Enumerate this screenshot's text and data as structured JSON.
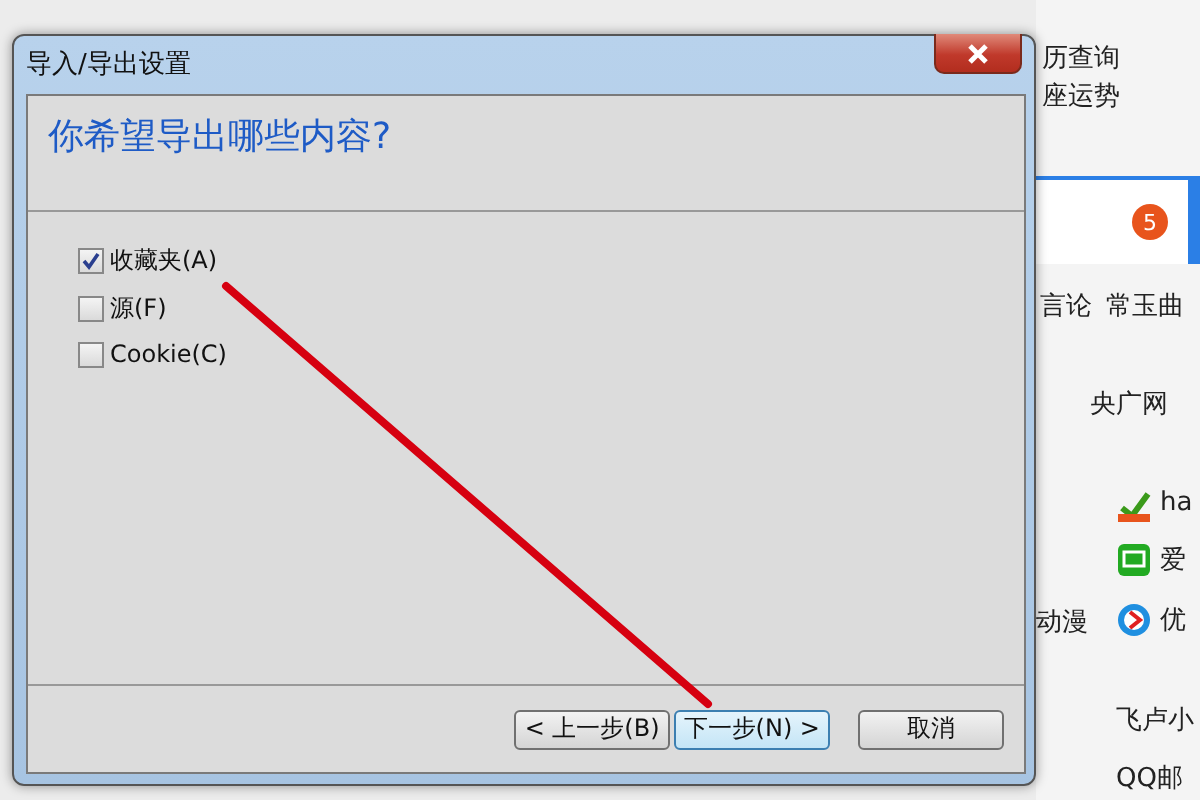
{
  "dialog": {
    "title": "导入/导出设置",
    "question": "你希望导出哪些内容?",
    "options": [
      {
        "label": "收藏夹(A)",
        "checked": true
      },
      {
        "label": "源(F)",
        "checked": false
      },
      {
        "label": "Cookie(C)",
        "checked": false
      }
    ],
    "buttons": [
      {
        "label": "< 上一步(B)",
        "focused": false
      },
      {
        "label": "下一步(N) >",
        "focused": true
      },
      {
        "label": "取消",
        "focused": false
      }
    ]
  },
  "background_page": {
    "links_top": [
      "历查询",
      "座运势"
    ],
    "badge": "5",
    "links_mid": [
      "言论",
      "常玉曲"
    ],
    "site": "央广网",
    "sites": [
      "ha",
      "爱",
      "优"
    ],
    "side_link": "动漫",
    "links_bottom": [
      "飞卢小",
      "QQ邮"
    ]
  }
}
